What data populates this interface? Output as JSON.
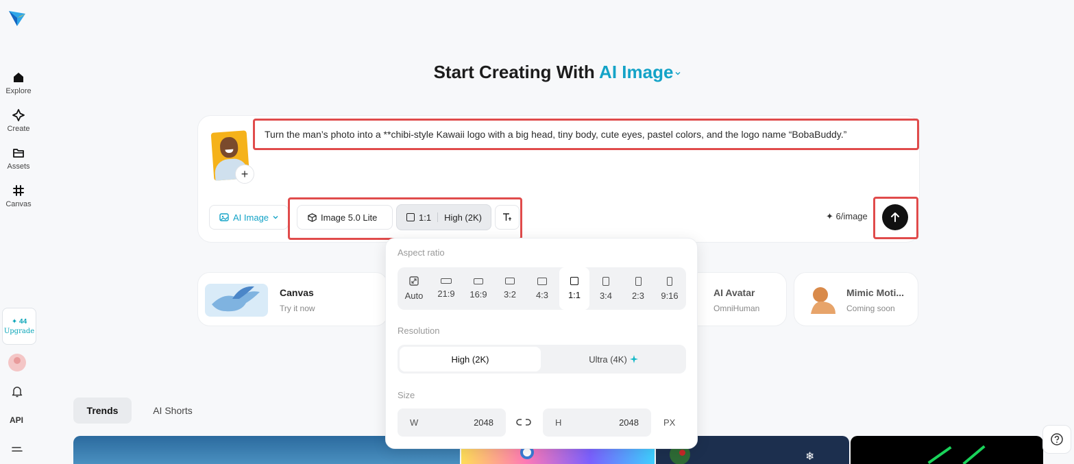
{
  "sidebar": {
    "items": [
      {
        "label": "Explore",
        "icon": "home-icon"
      },
      {
        "label": "Create",
        "icon": "sparkle-icon"
      },
      {
        "label": "Assets",
        "icon": "folder-icon"
      },
      {
        "label": "Canvas",
        "icon": "grid-icon"
      }
    ],
    "upgrade": {
      "points": "✦ 44",
      "label": "Upgrade"
    },
    "api_label": "API"
  },
  "header": {
    "title_prefix": "Start Creating With",
    "title_accent": "AI Image"
  },
  "composer": {
    "prompt": "Turn the man’s photo into a **chibi-style Kawaii logo with a big head, tiny body, cute eyes, pastel colors, and the logo name “BobaBuddy.”",
    "mode_label": "AI Image",
    "model_label": "Image 5.0 Lite",
    "ratio_label": "1:1",
    "resolution_label": "High (2K)",
    "credits": "✦ 6/image",
    "accent_color": "#14a3c7"
  },
  "features": [
    {
      "title": "Canvas",
      "subtitle": "Try it now"
    },
    {
      "title": "AI Avatar",
      "subtitle": "OmniHuman"
    },
    {
      "title": "Mimic Moti...",
      "subtitle": "Coming soon"
    }
  ],
  "tabs": [
    "Trends",
    "AI Shorts"
  ],
  "popup": {
    "aspect_ratio_heading": "Aspect ratio",
    "ratios": [
      "Auto",
      "21:9",
      "16:9",
      "3:2",
      "4:3",
      "1:1",
      "3:4",
      "2:3",
      "9:16"
    ],
    "selected_ratio": "1:1",
    "resolution_heading": "Resolution",
    "resolutions": [
      "High (2K)",
      "Ultra (4K)"
    ],
    "selected_resolution": "High (2K)",
    "size_heading": "Size",
    "width_key": "W",
    "width_value": "2048",
    "height_key": "H",
    "height_value": "2048",
    "unit": "PX"
  }
}
